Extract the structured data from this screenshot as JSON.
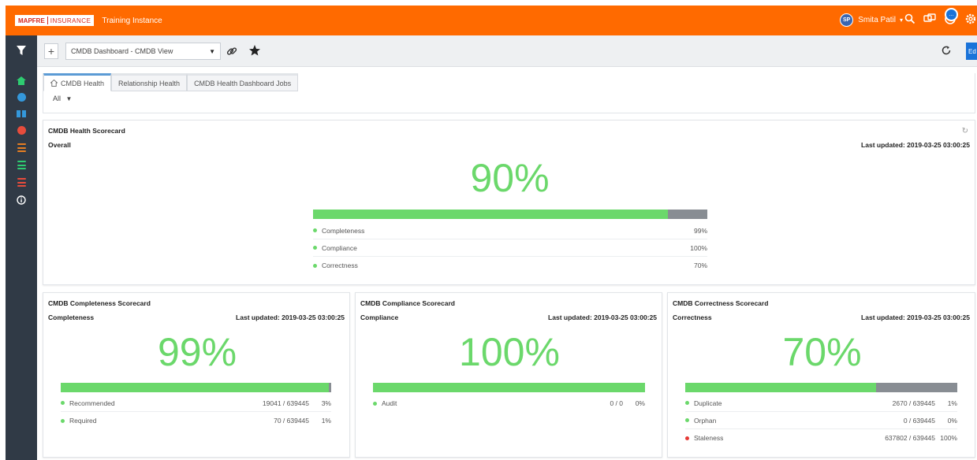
{
  "header": {
    "logo_brand": "MAPFRE",
    "logo_product": "INSURANCE",
    "instance_name": "Training Instance",
    "user_initials": "SP",
    "user_name": "Smita Patil",
    "user_caret": "▾",
    "notification_count": "…"
  },
  "leftnav": {
    "items": [
      {
        "icon": "filter-icon"
      },
      {
        "icon": "home-icon",
        "color": "#2ecc71"
      },
      {
        "icon": "help-icon",
        "color": "#3498db"
      },
      {
        "icon": "book-icon",
        "color": "#3498db"
      },
      {
        "icon": "alert-icon",
        "color": "#e74c3c"
      },
      {
        "icon": "list-icon",
        "color": "#e67e22"
      },
      {
        "icon": "list-icon",
        "color": "#2ecc71"
      },
      {
        "icon": "list-icon",
        "color": "#e74c3c"
      },
      {
        "icon": "info-icon",
        "color": "#ffffff"
      }
    ]
  },
  "toolbar": {
    "add_label": "+",
    "dashboard_selected": "CMDB Dashboard - CMDB View",
    "dropdown_caret": "▼",
    "edit_label": "Ed"
  },
  "tabs": [
    {
      "label": "CMDB Health",
      "active": true
    },
    {
      "label": "Relationship Health",
      "active": false
    },
    {
      "label": "CMDB Health Dashboard Jobs",
      "active": false
    }
  ],
  "filter": {
    "value": "All",
    "caret": "▼"
  },
  "health_card": {
    "title": "CMDB Health Scorecard",
    "subtitle": "Overall",
    "last_updated": "Last updated: 2019-03-25 03:00:25",
    "percent": "90%",
    "fill_fraction": 0.9,
    "rows": [
      {
        "label": "Completeness",
        "value": "99%",
        "dot": "#6bd86b"
      },
      {
        "label": "Compliance",
        "value": "100%",
        "dot": "#6bd86b"
      },
      {
        "label": "Correctness",
        "value": "70%",
        "dot": "#6bd86b"
      }
    ]
  },
  "completeness_card": {
    "title": "CMDB Completeness Scorecard",
    "subtitle": "Completeness",
    "last_updated": "Last updated: 2019-03-25 03:00:25",
    "percent": "99%",
    "fill_fraction": 0.99,
    "rows": [
      {
        "label": "Recommended",
        "value": "19041 / 639445",
        "pct": "3%",
        "dot": "#6bd86b"
      },
      {
        "label": "Required",
        "value": "70 / 639445",
        "pct": "1%",
        "dot": "#6bd86b"
      }
    ]
  },
  "compliance_card": {
    "title": "CMDB Compliance Scorecard",
    "subtitle": "Compliance",
    "last_updated": "Last updated: 2019-03-25 03:00:25",
    "percent": "100%",
    "fill_fraction": 1.0,
    "rows": [
      {
        "label": "Audit",
        "value": "0 / 0",
        "pct": "0%",
        "dot": "#6bd86b"
      }
    ]
  },
  "correctness_card": {
    "title": "CMDB Correctness Scorecard",
    "subtitle": "Correctness",
    "last_updated": "Last updated: 2019-03-25 03:00:25",
    "percent": "70%",
    "fill_fraction": 0.7,
    "rows": [
      {
        "label": "Duplicate",
        "value": "2670 / 639445",
        "pct": "1%",
        "dot": "#6bd86b"
      },
      {
        "label": "Orphan",
        "value": "0 / 639445",
        "pct": "0%",
        "dot": "#6bd86b"
      },
      {
        "label": "Staleness",
        "value": "637802 / 639445",
        "pct": "100%",
        "dot": "#e53935"
      }
    ]
  }
}
